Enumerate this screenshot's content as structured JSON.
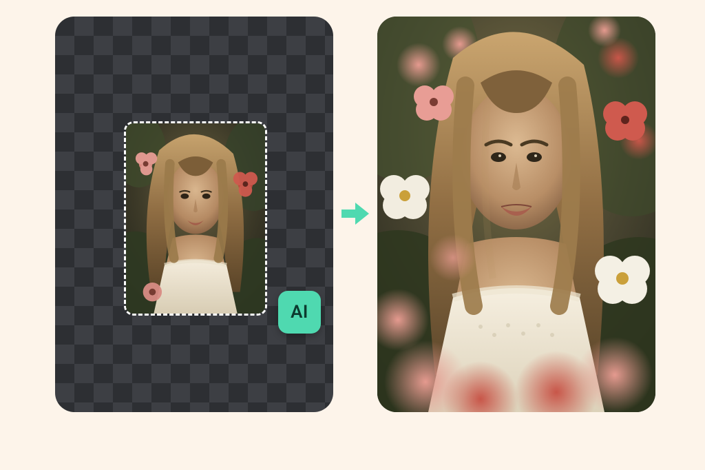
{
  "badge": {
    "ai_label": "AI"
  },
  "colors": {
    "accent": "#4fd9b0",
    "page_bg": "#fdf4ea",
    "checker_dark": "#2d2f33",
    "checker_light": "#3d3f44"
  },
  "icons": {
    "arrow": "arrow-right-icon",
    "ai_badge": "ai-badge-icon"
  },
  "panels": {
    "before": "before-canvas",
    "after": "after-result"
  }
}
